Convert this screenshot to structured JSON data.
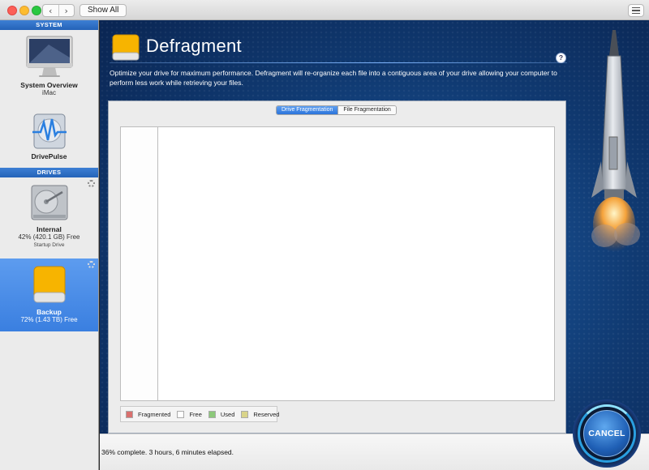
{
  "titlebar": {
    "back_glyph": "‹",
    "forward_glyph": "›",
    "show_all_label": "Show All"
  },
  "sidebar": {
    "system_header": "SYSTEM",
    "drives_header": "DRIVES",
    "system_items": [
      {
        "label": "System Overview",
        "sub": "iMac",
        "icon": "imac-icon"
      },
      {
        "label": "DrivePulse",
        "sub": "",
        "icon": "drivepulse-icon"
      }
    ],
    "drive_items": [
      {
        "label": "Internal",
        "sub": "42% (420.1 GB) Free",
        "sub2": "Startup Drive",
        "icon": "hard-drive-icon"
      },
      {
        "label": "Backup",
        "sub": "72% (1.43 TB) Free",
        "icon": "external-drive-icon",
        "selected": true
      }
    ]
  },
  "main": {
    "title": "Defragment",
    "help_label": "?",
    "description": "Optimize your drive for maximum performance. Defragment will re-organize each file into a contiguous area of your drive allowing your computer to perform less work while retrieving your files.",
    "tabs": [
      {
        "label": "Drive Fragmentation",
        "active": true
      },
      {
        "label": "File Fragmentation",
        "active": false
      }
    ],
    "legend": [
      {
        "label": "Fragmented",
        "color": "#d9706e"
      },
      {
        "label": "Free",
        "color": "#ffffff"
      },
      {
        "label": "Used",
        "color": "#8cc87a"
      },
      {
        "label": "Reserved",
        "color": "#d9d48a"
      }
    ],
    "status": "36% complete. 3 hours, 6 minutes elapsed.",
    "cancel_label": "CANCEL"
  },
  "colors": {
    "accent": "#2b74db",
    "background_blue": "#103a72"
  }
}
